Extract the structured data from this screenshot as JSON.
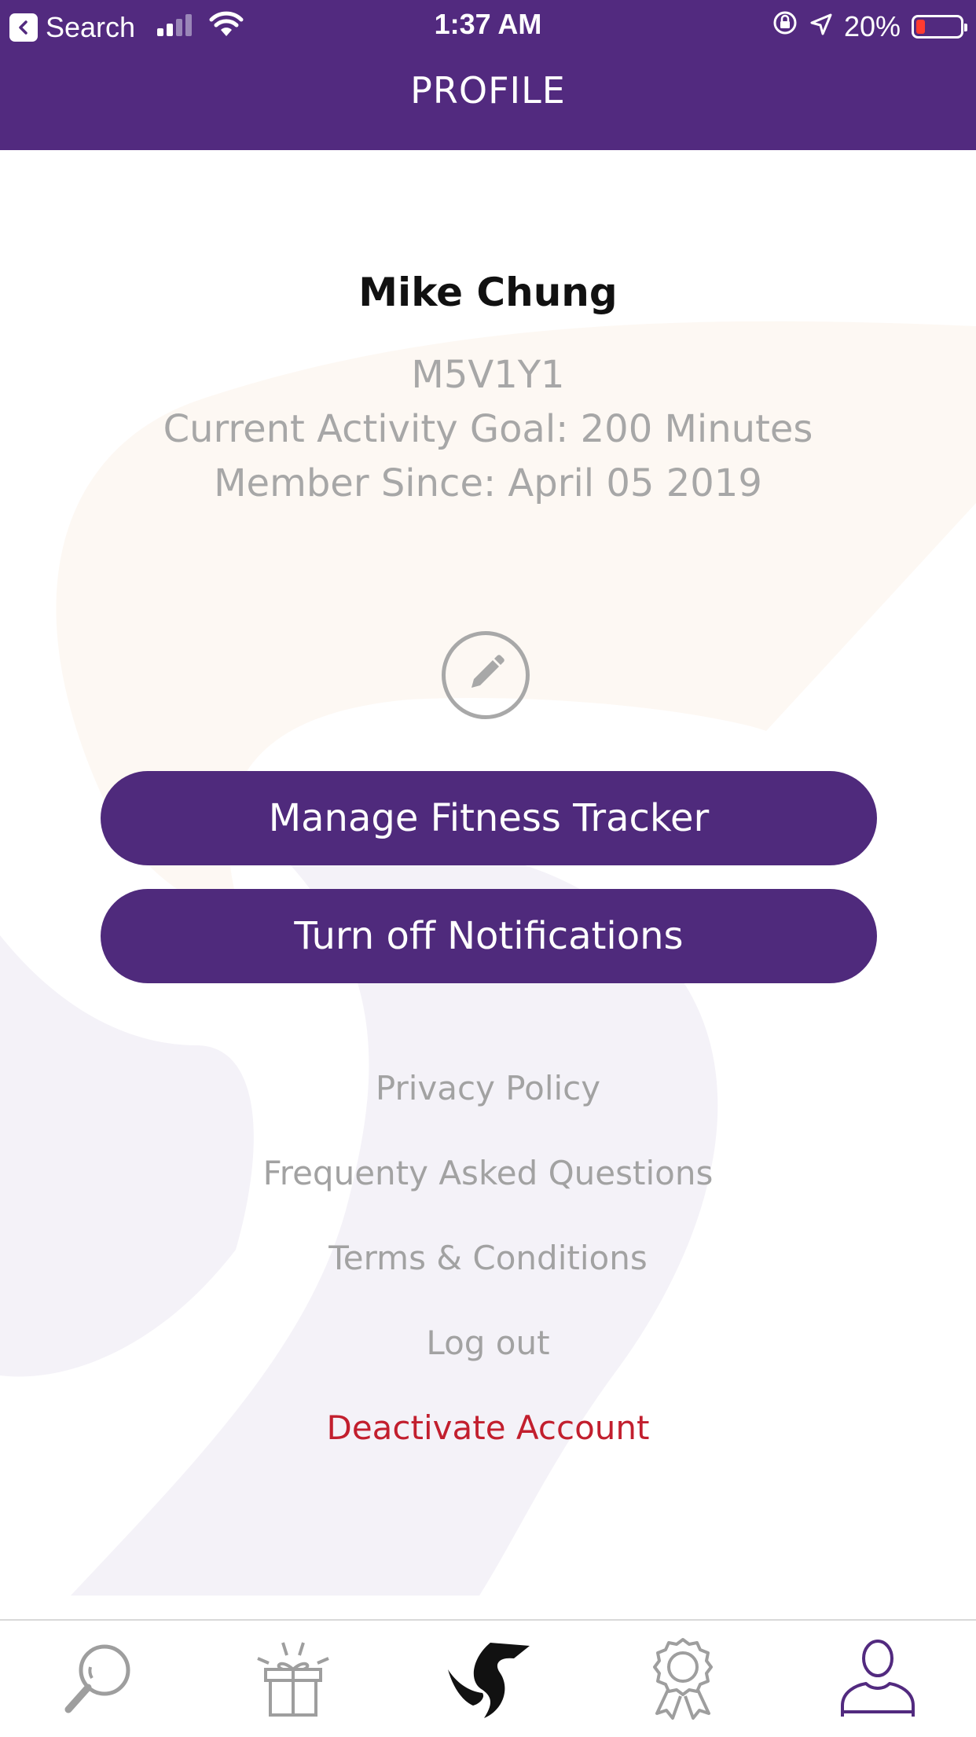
{
  "status_bar": {
    "back_label": "Search",
    "time": "1:37 AM",
    "battery": "20%",
    "battery_level": 0.2,
    "icons": [
      "signal-icon",
      "wifi-icon",
      "orientation-lock-icon",
      "location-icon",
      "battery-icon"
    ]
  },
  "nav": {
    "title": "PROFILE"
  },
  "profile": {
    "name": "Mike Chung",
    "postal_code": "M5V1Y1",
    "activity_goal": "Current Activity Goal: 200 Minutes",
    "member_since": "Member Since:  April 05 2019"
  },
  "actions": {
    "edit_icon": "pencil-icon",
    "manage_tracker": "Manage Fitness Tracker",
    "notifications": "Turn off Notifications"
  },
  "links": {
    "privacy": "Privacy Policy",
    "faq": "Frequenty Asked Questions",
    "terms": "Terms & Conditions",
    "logout": "Log out",
    "deactivate": "Deactivate Account"
  },
  "tab_bar": {
    "tabs": [
      {
        "icon": "search-icon"
      },
      {
        "icon": "gift-icon"
      },
      {
        "icon": "brand-logo-icon"
      },
      {
        "icon": "award-ribbon-icon"
      },
      {
        "icon": "profile-icon",
        "active": true
      }
    ]
  },
  "colors": {
    "brand_purple": "#522a7f",
    "button_purple": "#4f2a7c",
    "danger": "#c21f2e",
    "muted_text": "#a7a7a7"
  }
}
